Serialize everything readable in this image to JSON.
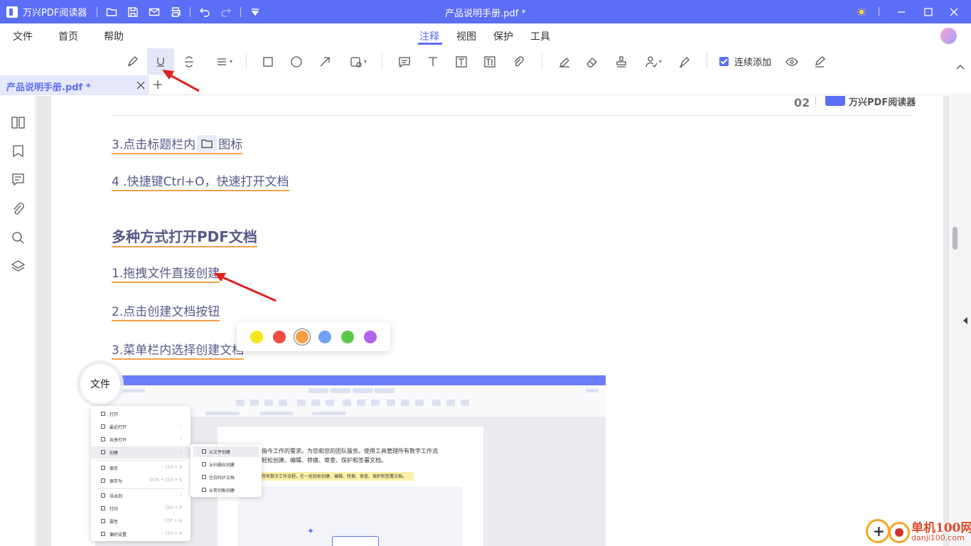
{
  "app": {
    "name": "万兴PDF阅读器",
    "window_title": "产品说明手册.pdf *",
    "accent_color": "#5b6ef6"
  },
  "titlebar_icons": [
    "folder-open-icon",
    "save-icon",
    "mail-icon",
    "print-icon",
    "undo-icon",
    "redo-icon",
    "dropdown-icon"
  ],
  "window_controls": [
    "theme-sun-icon",
    "minimize-icon",
    "maximize-icon",
    "close-icon"
  ],
  "menu": {
    "left": [
      "文件",
      "首页",
      "帮助"
    ],
    "right": [
      "注释",
      "视图",
      "保护",
      "工具"
    ],
    "active": "注释"
  },
  "toolbar": {
    "tools": [
      "highlight-pen",
      "underline",
      "strikethrough",
      "text-align",
      "rectangle",
      "circle",
      "arrow",
      "shape",
      "comment",
      "text",
      "textbox",
      "text-field",
      "attachment",
      "eraser-pen",
      "eraser",
      "stamp",
      "signature",
      "pen-sign"
    ],
    "active_tool": "underline",
    "continuous_add_label": "连续添加",
    "continuous_add_checked": true
  },
  "tabs": {
    "doc_tab_label": "产品说明手册.pdf *"
  },
  "sidebar_icons": [
    "thumbnails-icon",
    "bookmark-icon",
    "comments-icon",
    "attachments-icon",
    "search-icon",
    "layers-icon"
  ],
  "page": {
    "page_number": "02",
    "brand": "万兴PDF阅读器",
    "lines": {
      "l1_before": "3.点击标题栏内",
      "l1_after": "图标",
      "l2": "4 .快捷键Ctrl+O，快速打开文档",
      "heading": "多种方式打开PDF文档",
      "l3": "1.拖拽文件直接创建",
      "l4": "2.点击创建文档按钮",
      "l5": "3.菜单栏内选择创建文档"
    },
    "underline_color": "#f5a14a"
  },
  "color_picker": {
    "colors": [
      "#f8e71c",
      "#f04e43",
      "#f5a14a",
      "#6fa2f5",
      "#5cc84a",
      "#b266e8"
    ],
    "selected_index": 2
  },
  "screenshot": {
    "file_label": "文件",
    "menu_items": [
      {
        "label": "打开",
        "shortcut": ""
      },
      {
        "label": "最近打开",
        "shortcut": "›"
      },
      {
        "label": "共享打开",
        "shortcut": "›"
      },
      {
        "label": "创建",
        "shortcut": "›"
      },
      {
        "label": "保存",
        "shortcut": "Ctrl + S"
      },
      {
        "label": "保存为",
        "shortcut": "Shift + Ctrl + S"
      },
      {
        "label": "导出到",
        "shortcut": "›"
      },
      {
        "label": "打印",
        "shortcut": "Ctrl + P"
      },
      {
        "label": "属性",
        "shortcut": "Ctrl + D"
      },
      {
        "label": "偏好设置",
        "shortcut": "Ctrl + K"
      }
    ],
    "submenu_items": [
      "从文件创建",
      "从扫描仪创建",
      "空白PDF文档",
      "从剪切板创建"
    ],
    "doc_text_1": "指今工作的需求。为您和您的团队服务。使用工具管理所有数字工作流",
    "doc_text_2": "轻松创建、编辑、转换、审查、保护和签署文档。",
    "doc_text_3": "所有数字工作流程，在一处轻松创建、编辑、转换、审查、保护和签署文档。"
  },
  "watermark": {
    "title": "单机100网",
    "url": "danji100.com"
  }
}
